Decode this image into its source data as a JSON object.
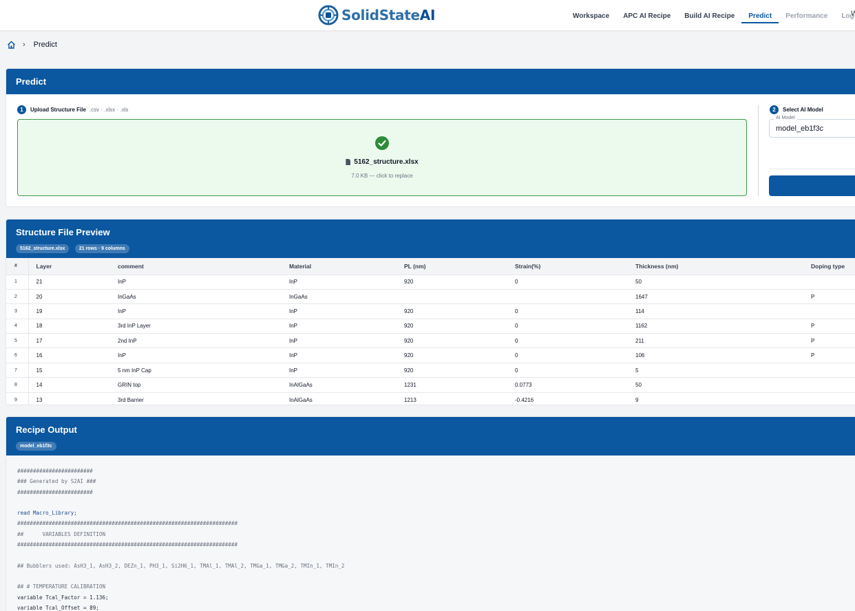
{
  "brand": {
    "name_part1": "Solid",
    "name_part2": "State",
    "name_part3": "AI"
  },
  "nav": {
    "items": [
      {
        "label": "Workspace",
        "state": "default"
      },
      {
        "label": "APC AI Recipe",
        "state": "default"
      },
      {
        "label": "Build AI Recipe",
        "state": "default"
      },
      {
        "label": "Predict",
        "state": "active"
      },
      {
        "label": "Performance",
        "state": "disabled"
      },
      {
        "label": "Logs",
        "state": "disabled"
      }
    ],
    "overflow_glyph": "W"
  },
  "breadcrumb": {
    "home_icon": "home-icon",
    "separator": "›",
    "current": "Predict"
  },
  "predict": {
    "title": "Predict",
    "upload": {
      "step": "1",
      "label": "Upload Structure File",
      "hint": ".csv · .xlsx · .xls",
      "file_name": "5162_structure.xlsx",
      "file_meta": "7.0 KB — click to replace"
    },
    "model": {
      "step": "2",
      "label": "Select AI Model",
      "field_legend": "AI Model",
      "selected": "model_eb1f3c"
    }
  },
  "preview": {
    "title": "Structure File Preview",
    "chips": [
      "5162_structure.xlsx",
      "21 rows · 9 columns"
    ],
    "columns": [
      "#",
      "Layer",
      "comment",
      "Material",
      "PL (nm)",
      "Strain(%)",
      "Thickness (nm)",
      "Doping type"
    ],
    "rows": [
      [
        "1",
        "21",
        "InP",
        "InP",
        "920",
        "0",
        "50",
        ""
      ],
      [
        "2",
        "20",
        "InGaAs",
        "InGaAs",
        "",
        "",
        "1647",
        "P"
      ],
      [
        "3",
        "19",
        "InP",
        "InP",
        "920",
        "0",
        "114",
        ""
      ],
      [
        "4",
        "18",
        "3rd InP Layer",
        "InP",
        "920",
        "0",
        "1162",
        "P"
      ],
      [
        "5",
        "17",
        "2nd InP",
        "InP",
        "920",
        "0",
        "211",
        "P"
      ],
      [
        "6",
        "16",
        "InP",
        "InP",
        "920",
        "0",
        "106",
        "P"
      ],
      [
        "7",
        "15",
        "5 nm InP Cap",
        "InP",
        "920",
        "0",
        "5",
        ""
      ],
      [
        "8",
        "14",
        "GRIN top",
        "InAlGaAs",
        "1231",
        "0.0773",
        "50",
        ""
      ],
      [
        "9",
        "13",
        "3rd Barrier",
        "InAlGaAs",
        "1213",
        "-0.4216",
        "9",
        ""
      ]
    ]
  },
  "recipe": {
    "title": "Recipe Output",
    "chip": "model_eb1f3c",
    "lines": [
      {
        "text": "########################",
        "style": "comment"
      },
      {
        "text": "### Generated by S2AI ###",
        "style": "comment"
      },
      {
        "text": "########################",
        "style": "comment"
      },
      {
        "text": "",
        "style": "comment"
      },
      {
        "text": "read Macro_Library;",
        "style": "kw"
      },
      {
        "text": "######################################################################",
        "style": "comment"
      },
      {
        "text": "##      VARIABLES DEFINITION",
        "style": "comment"
      },
      {
        "text": "######################################################################",
        "style": "comment"
      },
      {
        "text": "",
        "style": "comment"
      },
      {
        "text": "## Bubblers used: AsH3_1, AsH3_2, DEZn_1, PH3_1, Si2H6_1, TMAl_1, TMAl_2, TMGa_1, TMGa_2, TMIn_1, TMIn_2",
        "style": "comment"
      },
      {
        "text": "",
        "style": "comment"
      },
      {
        "text": "## # TEMPERATURE CALIBRATION",
        "style": "comment"
      },
      {
        "text": "variable Tcal_Factor = 1.136;",
        "style": "plain"
      },
      {
        "text": "variable Tcal_Offset = 89;",
        "style": "plain"
      }
    ]
  },
  "colors": {
    "primary": "#0b57a0",
    "success": "#2e8b3a",
    "success_bg": "#ecfaee"
  }
}
